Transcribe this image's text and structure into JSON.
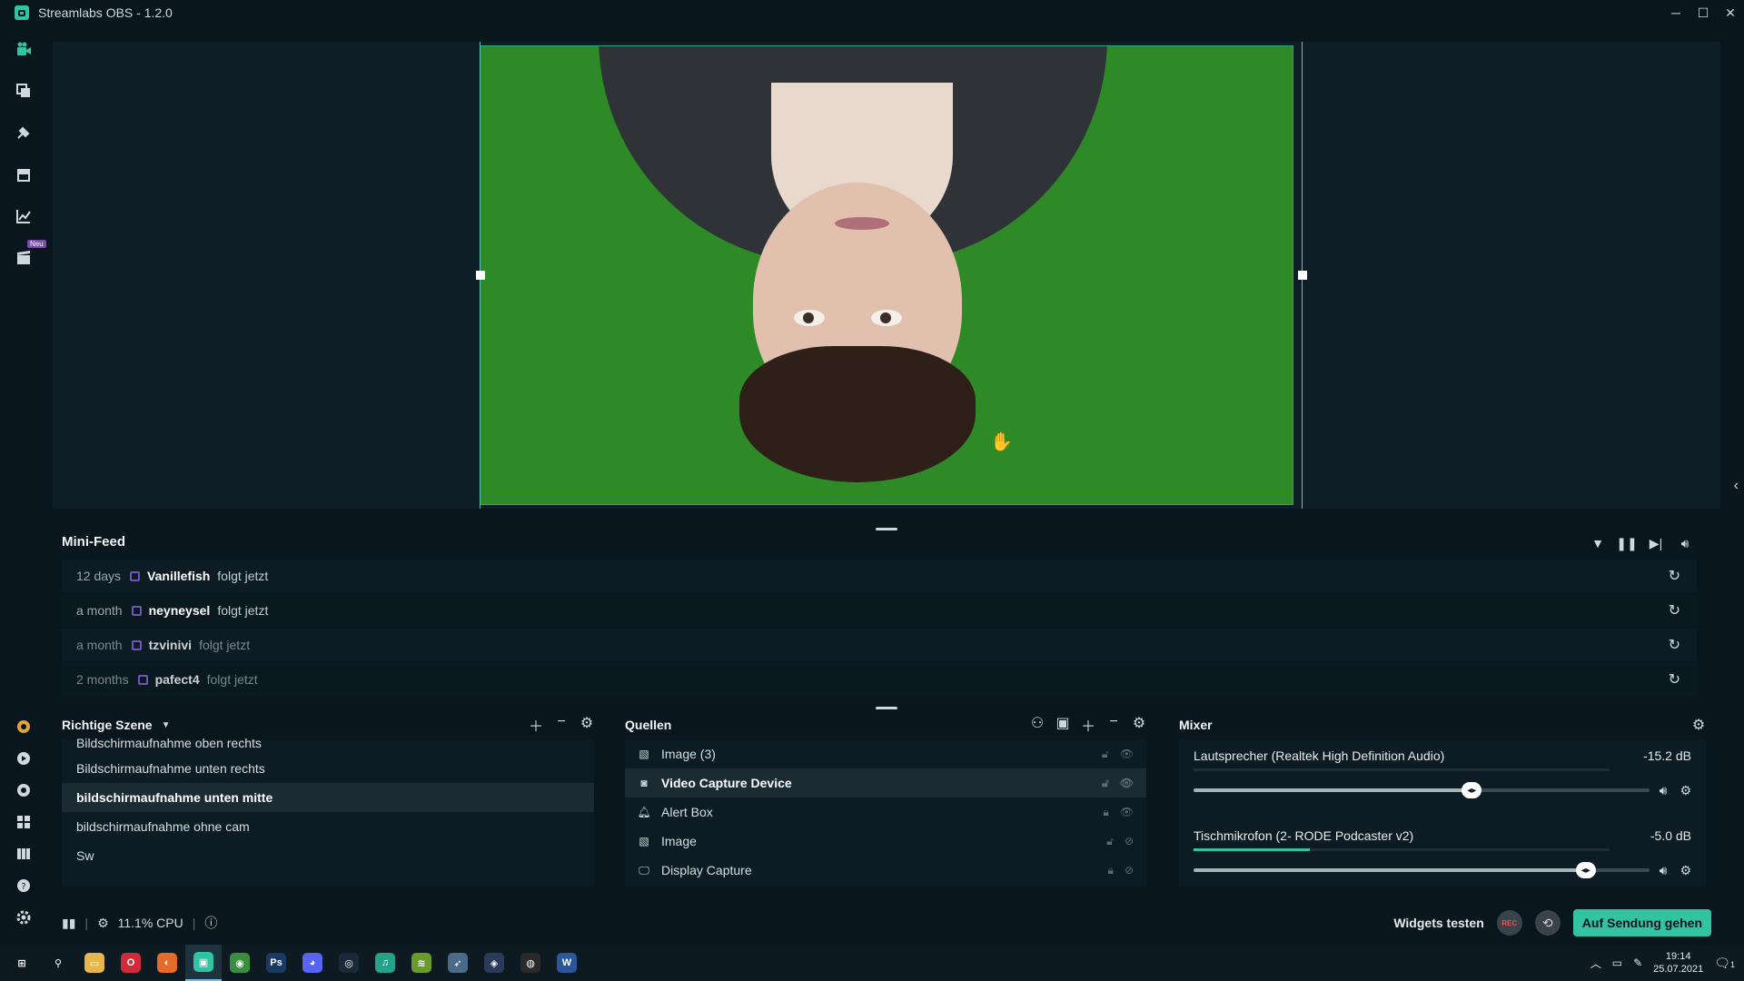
{
  "window": {
    "title": "Streamlabs OBS - 1.2.0",
    "minimize": "─",
    "maximize": "☐",
    "close": "✕"
  },
  "sidebar": {
    "neu_badge": "Neu",
    "items": [
      "editor-icon",
      "themes-icon",
      "apps-icon",
      "store-icon",
      "analytics-icon",
      "highlighter-icon"
    ],
    "bottom_items": [
      "prime-icon",
      "dashboard-icon",
      "chat-icon",
      "layout-icon",
      "studio-mode-icon",
      "help-icon",
      "settings-icon"
    ]
  },
  "minifeed": {
    "title": "Mini-Feed",
    "events": [
      {
        "time": "12 days",
        "user": "Vanillefish",
        "action": "folgt jetzt"
      },
      {
        "time": "a month",
        "user": "neyneysel",
        "action": "folgt jetzt"
      },
      {
        "time": "a month",
        "user": "tzvinivi",
        "action": "folgt jetzt"
      },
      {
        "time": "2 months",
        "user": "pafect4",
        "action": "folgt jetzt"
      }
    ]
  },
  "scenes": {
    "title": "Richtige Szene",
    "items": [
      "Bildschirmaufnahme oben rechts",
      "Bildschirmaufnahme unten rechts",
      "bildschirmaufnahme unten mitte",
      "bildschirmaufnahme ohne cam",
      "Sw"
    ],
    "selected_index": 2
  },
  "sources": {
    "title": "Quellen",
    "items": [
      {
        "name": "Image (3)",
        "icon": "image-icon"
      },
      {
        "name": "Video Capture Device",
        "icon": "camera-icon"
      },
      {
        "name": "Alert Box",
        "icon": "bell-icon"
      },
      {
        "name": "Image",
        "icon": "image-icon"
      },
      {
        "name": "Display Capture",
        "icon": "monitor-icon"
      }
    ],
    "selected_index": 1
  },
  "mixer": {
    "title": "Mixer",
    "channels": [
      {
        "name": "Lautsprecher (Realtek High Definition Audio)",
        "db": "-15.2 dB",
        "volume": 0.61,
        "level": 0.0
      },
      {
        "name": "Tischmikrofon (2- RODE Podcaster v2)",
        "db": "-5.0 dB",
        "volume": 0.86,
        "level": 0.28
      }
    ]
  },
  "status": {
    "cpu": "11.1% CPU",
    "widgets_label": "Widgets testen",
    "rec_label": "REC",
    "golive_label": "Auf Sendung gehen"
  },
  "taskbar": {
    "apps": [
      {
        "name": "windows-start-icon",
        "glyph": "⊞",
        "color": "#0d1a22"
      },
      {
        "name": "search-icon",
        "glyph": "⚲",
        "color": "#0d1a22"
      },
      {
        "name": "file-explorer-icon",
        "glyph": "▭",
        "color": "#e6b64a"
      },
      {
        "name": "opera-icon",
        "glyph": "O",
        "color": "#d02b3a"
      },
      {
        "name": "firefox-icon",
        "glyph": "◐",
        "color": "#e66a2a"
      },
      {
        "name": "streamlabs-icon",
        "glyph": "▣",
        "color": "#31c3a2"
      },
      {
        "name": "chrome-icon",
        "glyph": "◉",
        "color": "#3a8f3f"
      },
      {
        "name": "photoshop-icon",
        "glyph": "Ps",
        "color": "#1b3a63"
      },
      {
        "name": "discord-icon",
        "glyph": "◕",
        "color": "#5865f2"
      },
      {
        "name": "steam-icon",
        "glyph": "◎",
        "color": "#1b2838"
      },
      {
        "name": "music-app-icon",
        "glyph": "♫",
        "color": "#25a38a"
      },
      {
        "name": "layers-app-icon",
        "glyph": "≋",
        "color": "#6a9a2a"
      },
      {
        "name": "rocket-app-icon",
        "glyph": "➶",
        "color": "#4a6a8a"
      },
      {
        "name": "resolve-icon",
        "glyph": "◈",
        "color": "#2a3a5a"
      },
      {
        "name": "obs-icon",
        "glyph": "◍",
        "color": "#2a2a2a"
      },
      {
        "name": "word-icon",
        "glyph": "W",
        "color": "#2b579a"
      }
    ],
    "time": "19:14",
    "date": "25.07.2021",
    "notifications": "1"
  },
  "colors": {
    "accent": "#31c3a2",
    "background": "#09161d",
    "panel": "#0d1c24"
  }
}
